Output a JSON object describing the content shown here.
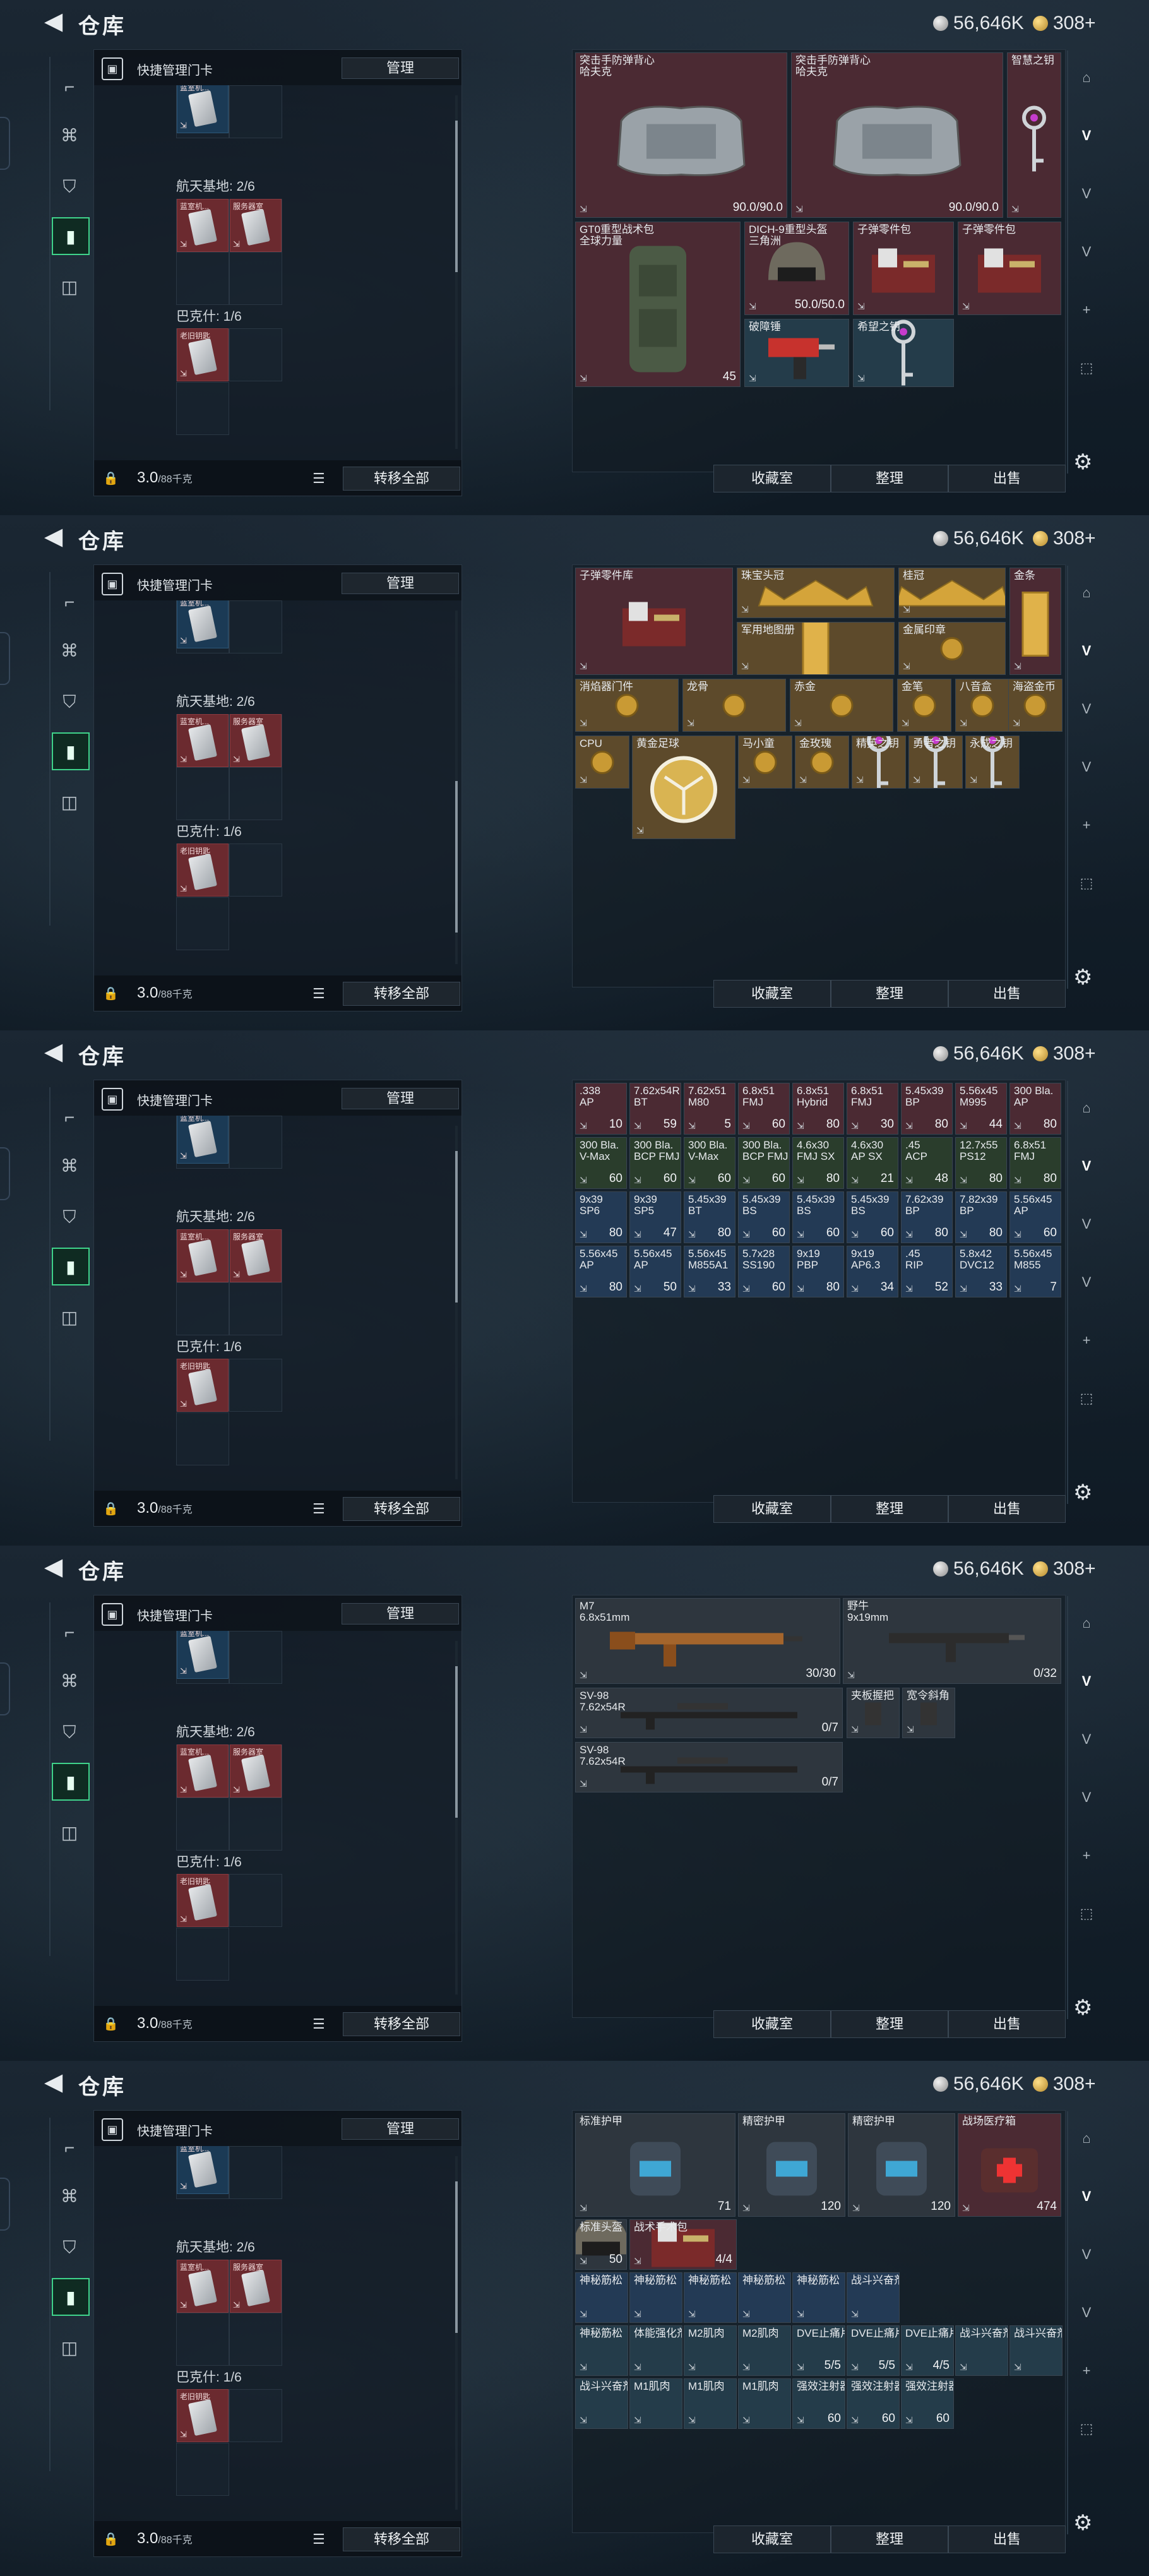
{
  "header": {
    "title": "仓库",
    "silver": "56,646K",
    "gold": "308+"
  },
  "left_panel": {
    "title": "快捷管理门卡",
    "manage_label": "管理",
    "section_aerospace": "航天基地: 2/6",
    "section_bakhmut": "巴克什: 1/6",
    "capacity": "3.0",
    "capacity_unit": "/88千克",
    "transfer_label": "转移全部",
    "card_tag_1": "蓝室机...",
    "card_tag_2": "服务器室",
    "card_tag_3": "老旧钥匙"
  },
  "actions": {
    "vault": "收藏室",
    "sort": "整理",
    "sell": "出售"
  },
  "side_nav": [
    "⬚",
    "▦",
    "V",
    "▣",
    "+",
    "⬚",
    "⚙"
  ],
  "pages": [
    {
      "items": [
        {
          "name": "突击手防弹背心\n哈夫克",
          "value": "90.0/90.0",
          "bg": "bg-red",
          "art": "vest"
        },
        {
          "name": "突击手防弹背心\n哈夫克",
          "value": "90.0/90.0",
          "bg": "bg-red",
          "art": "vest"
        },
        {
          "name": "智慧之钥",
          "value": "",
          "bg": "bg-red",
          "art": "key"
        },
        {
          "name": "GT0重型战术包\n全球力量",
          "value": "45",
          "bg": "bg-red",
          "art": "pack"
        },
        {
          "name": "DICH-9重型头盔\n三角洲",
          "value": "50.0/50.0",
          "bg": "bg-red",
          "art": "helm"
        },
        {
          "name": "子弹零件包",
          "value": "",
          "bg": "bg-red",
          "art": "kit"
        },
        {
          "name": "子弹零件包",
          "value": "",
          "bg": "bg-red",
          "art": "kit"
        },
        {
          "name": "破障锤",
          "value": "",
          "bg": "bg-teal",
          "art": "drill"
        },
        {
          "name": "希望之钥",
          "value": "",
          "bg": "bg-teal",
          "art": "key"
        }
      ]
    },
    {
      "items": [
        {
          "name": "子弹零件库",
          "value": "",
          "bg": "bg-red",
          "art": "kit"
        },
        {
          "name": "珠宝头冠",
          "value": "",
          "bg": "bg-gold",
          "art": "crown"
        },
        {
          "name": "桂冠",
          "value": "",
          "bg": "bg-gold",
          "art": "crown"
        },
        {
          "name": "金条",
          "value": "",
          "bg": "bg-red",
          "art": "bar"
        },
        {
          "name": "军用地图册",
          "value": "",
          "bg": "bg-gold",
          "art": "bar"
        },
        {
          "name": "金属印章",
          "value": "",
          "bg": "bg-gold",
          "art": "cup"
        },
        {
          "name": "消焰器门件",
          "value": "",
          "bg": "bg-gold",
          "art": "cup"
        },
        {
          "name": "龙骨",
          "value": "",
          "bg": "bg-gold",
          "art": "cup"
        },
        {
          "name": "赤金",
          "value": "",
          "bg": "bg-gold",
          "art": "cup"
        },
        {
          "name": "金笔",
          "value": "",
          "bg": "bg-gold",
          "art": "cup"
        },
        {
          "name": "八音盒",
          "value": "",
          "bg": "bg-gold",
          "art": "cup"
        },
        {
          "name": "海盗金币",
          "value": "",
          "bg": "bg-gold",
          "art": "cup"
        },
        {
          "name": "CPU",
          "value": "",
          "bg": "bg-gold",
          "art": "cup"
        },
        {
          "name": "黄金足球",
          "value": "",
          "bg": "bg-gold",
          "art": "ball"
        },
        {
          "name": "马小童",
          "value": "",
          "bg": "bg-gold",
          "art": "cup"
        },
        {
          "name": "金玫瑰",
          "value": "",
          "bg": "bg-gold",
          "art": "cup"
        },
        {
          "name": "精英之钥",
          "value": "",
          "bg": "bg-gold",
          "art": "key"
        },
        {
          "name": "勇者之钥",
          "value": "",
          "bg": "bg-gold",
          "art": "key"
        },
        {
          "name": "永成之钥",
          "value": "",
          "bg": "bg-gold",
          "art": "key"
        }
      ]
    },
    {
      "items": [
        {
          "name": ".338\nAP",
          "value": "10",
          "bg": "bg-red"
        },
        {
          "name": "7.62x54R\nBT",
          "value": "59",
          "bg": "bg-red"
        },
        {
          "name": "7.62x51\nM80",
          "value": "5",
          "bg": "bg-red"
        },
        {
          "name": "6.8x51\nFMJ",
          "value": "60",
          "bg": "bg-red"
        },
        {
          "name": "6.8x51\nHybrid",
          "value": "80",
          "bg": "bg-red"
        },
        {
          "name": "6.8x51\nFMJ",
          "value": "30",
          "bg": "bg-red"
        },
        {
          "name": "5.45x39\nBP",
          "value": "80",
          "bg": "bg-red"
        },
        {
          "name": "5.56x45\nM995",
          "value": "44",
          "bg": "bg-red"
        },
        {
          "name": "300 Bla.\nAP",
          "value": "80",
          "bg": "bg-red"
        },
        {
          "name": "300 Bla.\nV-Max",
          "value": "60",
          "bg": "bg-grn"
        },
        {
          "name": "300 Bla.\nBCP FMJ",
          "value": "60",
          "bg": "bg-grn"
        },
        {
          "name": "300 Bla.\nV-Max",
          "value": "60",
          "bg": "bg-grn"
        },
        {
          "name": "300 Bla.\nBCP FMJ",
          "value": "60",
          "bg": "bg-grn"
        },
        {
          "name": "4.6x30\nFMJ SX",
          "value": "80",
          "bg": "bg-grn"
        },
        {
          "name": "4.6x30\nAP SX",
          "value": "21",
          "bg": "bg-grn"
        },
        {
          "name": ".45\nACP",
          "value": "48",
          "bg": "bg-grn"
        },
        {
          "name": "12.7x55\nPS12",
          "value": "80",
          "bg": "bg-grn"
        },
        {
          "name": "6.8x51\nFMJ",
          "value": "80",
          "bg": "bg-grn"
        },
        {
          "name": "9x39\nSP6",
          "value": "80",
          "bg": "bg-blue"
        },
        {
          "name": "9x39\nSP5",
          "value": "47",
          "bg": "bg-blue"
        },
        {
          "name": "5.45x39\nBT",
          "value": "80",
          "bg": "bg-blue"
        },
        {
          "name": "5.45x39\nBS",
          "value": "60",
          "bg": "bg-blue"
        },
        {
          "name": "5.45x39\nBS",
          "value": "60",
          "bg": "bg-blue"
        },
        {
          "name": "5.45x39\nBS",
          "value": "60",
          "bg": "bg-blue"
        },
        {
          "name": "7.62x39\nBP",
          "value": "80",
          "bg": "bg-blue"
        },
        {
          "name": "7.82x39\nBP",
          "value": "80",
          "bg": "bg-blue"
        },
        {
          "name": "5.56x45\nAP",
          "value": "60",
          "bg": "bg-blue"
        },
        {
          "name": "5.56x45\nAP",
          "value": "80",
          "bg": "bg-blue"
        },
        {
          "name": "5.56x45\nAP",
          "value": "50",
          "bg": "bg-blue"
        },
        {
          "name": "5.56x45\nM855A1",
          "value": "33",
          "bg": "bg-blue"
        },
        {
          "name": "5.7x28\nSS190",
          "value": "60",
          "bg": "bg-blue"
        },
        {
          "name": "9x19\nPBP",
          "value": "80",
          "bg": "bg-blue"
        },
        {
          "name": "9x19\nAP6.3",
          "value": "34",
          "bg": "bg-blue"
        },
        {
          "name": ".45\nRIP",
          "value": "52",
          "bg": "bg-blue"
        },
        {
          "name": "5.8x42\nDVC12",
          "value": "33",
          "bg": "bg-blue"
        },
        {
          "name": "5.56x45\nM855",
          "value": "7",
          "bg": "bg-blue"
        }
      ]
    },
    {
      "items": [
        {
          "name": "M7\n6.8x51mm",
          "value": "30/30",
          "bg": "bg-gray",
          "art": "rifle-gold"
        },
        {
          "name": "野牛\n9x19mm",
          "value": "0/32",
          "bg": "bg-gray",
          "art": "smg"
        },
        {
          "name": "SV-98\n7.62x54R",
          "value": "0/7",
          "bg": "bg-gray",
          "art": "sniper"
        },
        {
          "name": "夹板握把",
          "value": "",
          "bg": "bg-gray",
          "art": "grip"
        },
        {
          "name": "宽令斜角",
          "value": "",
          "bg": "bg-gray",
          "art": "grip"
        },
        {
          "name": "SV-98\n7.62x54R",
          "value": "0/7",
          "bg": "bg-gray",
          "art": "sniper"
        }
      ]
    },
    {
      "items": [
        {
          "name": "标准护甲",
          "value": "71",
          "bg": "bg-gray",
          "art": "armor"
        },
        {
          "name": "精密护甲",
          "value": "120",
          "bg": "bg-gray",
          "art": "armor"
        },
        {
          "name": "精密护甲",
          "value": "120",
          "bg": "bg-gray",
          "art": "armor"
        },
        {
          "name": "战场医疗箱",
          "value": "474",
          "bg": "bg-red",
          "art": "medkit"
        },
        {
          "name": "标准头盔",
          "value": "50",
          "bg": "bg-gray",
          "art": "helm"
        },
        {
          "name": "战术手术包",
          "value": "4/4",
          "bg": "bg-red",
          "art": "kit"
        },
        {
          "name": "神秘筋松",
          "value": "",
          "bg": "bg-blue"
        },
        {
          "name": "神秘筋松",
          "value": "",
          "bg": "bg-blue"
        },
        {
          "name": "神秘筋松",
          "value": "",
          "bg": "bg-blue"
        },
        {
          "name": "神秘筋松",
          "value": "",
          "bg": "bg-blue"
        },
        {
          "name": "神秘筋松",
          "value": "",
          "bg": "bg-blue"
        },
        {
          "name": "战斗兴奋剂",
          "value": "",
          "bg": "bg-blue"
        },
        {
          "name": "神秘筋松",
          "value": "",
          "bg": "bg-teal"
        },
        {
          "name": "体能强化剂",
          "value": "",
          "bg": "bg-teal"
        },
        {
          "name": "M2肌肉",
          "value": "",
          "bg": "bg-teal"
        },
        {
          "name": "M2肌肉",
          "value": "",
          "bg": "bg-teal"
        },
        {
          "name": "DVE止痛片",
          "value": "5/5",
          "bg": "bg-teal"
        },
        {
          "name": "DVE止痛片",
          "value": "5/5",
          "bg": "bg-teal"
        },
        {
          "name": "DVE止痛片",
          "value": "4/5",
          "bg": "bg-teal"
        },
        {
          "name": "战斗兴奋剂",
          "value": "",
          "bg": "bg-teal"
        },
        {
          "name": "战斗兴奋剂",
          "value": "",
          "bg": "bg-teal"
        },
        {
          "name": "战斗兴奋剂",
          "value": "",
          "bg": "bg-teal"
        },
        {
          "name": "M1肌肉",
          "value": "",
          "bg": "bg-teal"
        },
        {
          "name": "M1肌肉",
          "value": "",
          "bg": "bg-teal"
        },
        {
          "name": "M1肌肉",
          "value": "",
          "bg": "bg-teal"
        },
        {
          "name": "强效注射器",
          "value": "60",
          "bg": "bg-teal"
        },
        {
          "name": "强效注射器",
          "value": "60",
          "bg": "bg-teal"
        },
        {
          "name": "强效注射器",
          "value": "60",
          "bg": "bg-teal"
        }
      ]
    }
  ]
}
